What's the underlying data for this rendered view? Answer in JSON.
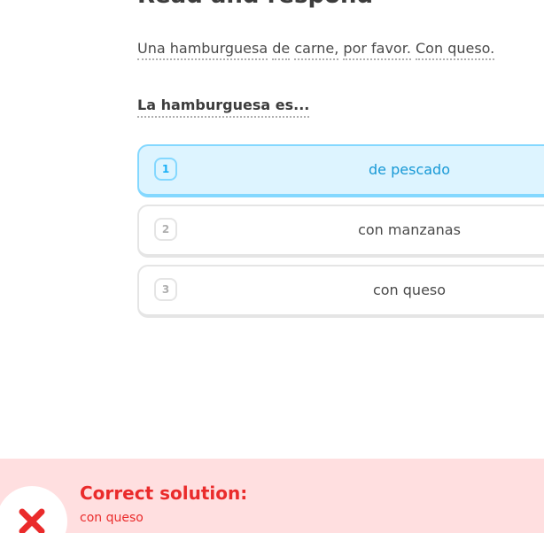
{
  "header": {
    "title": "Read and respond"
  },
  "prompt": {
    "sentence_words": [
      "Una hamburguesa",
      "de",
      "carne,",
      "por favor.",
      "Con queso."
    ],
    "question": "La hamburguesa es..."
  },
  "choices": [
    {
      "number": "1",
      "label": "de pescado",
      "selected": true
    },
    {
      "number": "2",
      "label": "con manzanas",
      "selected": false
    },
    {
      "number": "3",
      "label": "con queso",
      "selected": false
    }
  ],
  "feedback": {
    "title": "Correct solution:",
    "answer": "con queso",
    "icon": "x-icon",
    "color": "#ea2b2b",
    "background": "#ffdfe0"
  },
  "colors": {
    "selected_bg": "#ddf4ff",
    "selected_border": "#84d8ff",
    "selected_text": "#1899d6",
    "default_border": "#e5e5e5"
  }
}
